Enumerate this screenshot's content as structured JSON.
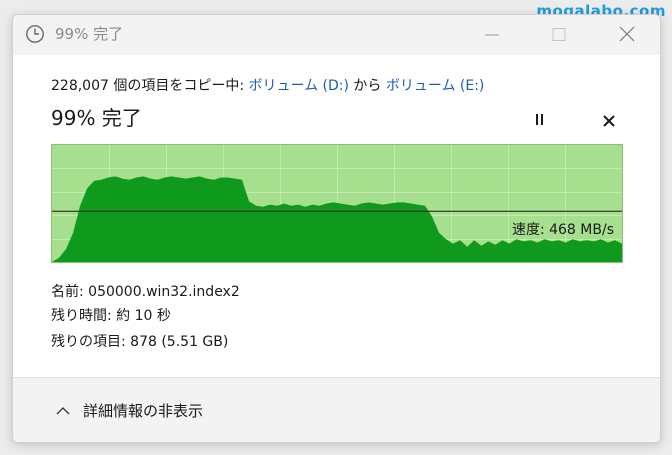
{
  "watermark": "mogalabo.com",
  "window": {
    "title": "99% 完了"
  },
  "copy": {
    "prefix": "228,007 個の項目をコピー中: ",
    "source": "ボリューム (D:)",
    "middle": " から ",
    "destination": "ボリューム (E:)",
    "percent_text": "99% 完了"
  },
  "graph": {
    "speed_text": "速度: 468 MB/s",
    "fill_color": "#0f9a1e",
    "background_color": "#a6df8e",
    "grid_color": "#c4eab2",
    "speed_line_mbps": 468,
    "max_mbps": 1080,
    "throughput_mbps": [
      0,
      40,
      120,
      270,
      520,
      680,
      750,
      760,
      780,
      790,
      770,
      760,
      780,
      790,
      770,
      760,
      780,
      790,
      780,
      770,
      780,
      790,
      770,
      760,
      780,
      780,
      770,
      760,
      560,
      520,
      510,
      530,
      520,
      540,
      520,
      530,
      510,
      530,
      520,
      540,
      550,
      540,
      530,
      520,
      540,
      550,
      540,
      530,
      540,
      550,
      550,
      540,
      530,
      520,
      420,
      270,
      210,
      170,
      200,
      140,
      200,
      150,
      190,
      160,
      200,
      170,
      210,
      190,
      200,
      180,
      210,
      190,
      200,
      180,
      210,
      190,
      200,
      190,
      210,
      180,
      200,
      170
    ]
  },
  "details": {
    "name_label": "名前: ",
    "name_value": "050000.win32.index2",
    "time_label": "残り時間: ",
    "time_value": "約 10 秒",
    "items_label": "残りの項目: ",
    "items_value": "878 (5.51 GB)"
  },
  "footer": {
    "toggle_label": "詳細情報の非表示"
  }
}
